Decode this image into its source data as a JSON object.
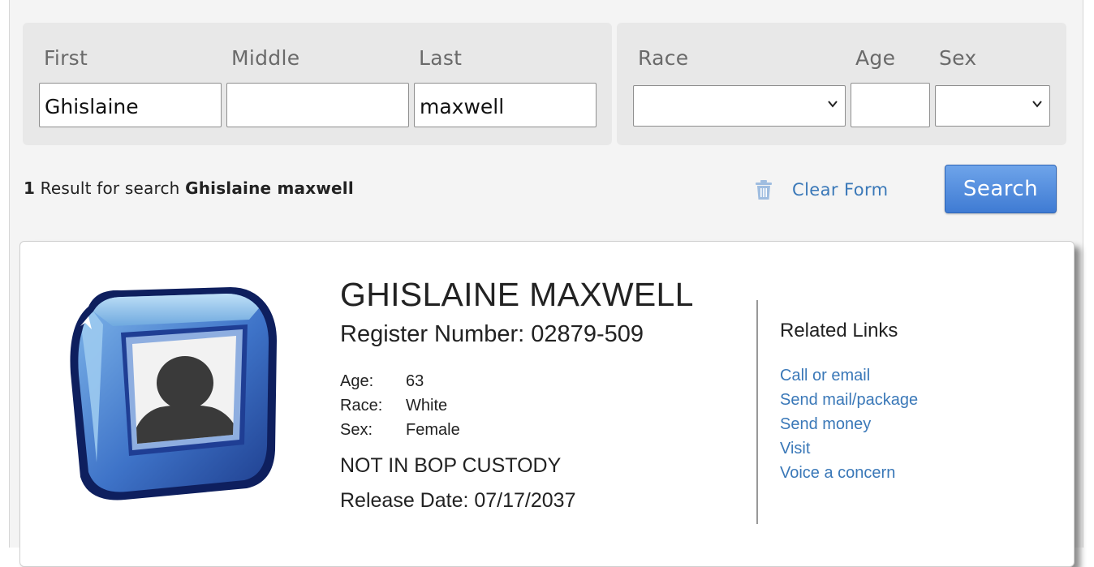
{
  "search_form": {
    "first_label": "First",
    "middle_label": "Middle",
    "last_label": "Last",
    "first_value": "Ghislaine",
    "middle_value": "",
    "last_value": "maxwell",
    "race_label": "Race",
    "age_label": "Age",
    "sex_label": "Sex",
    "race_selected": "",
    "age_value": "",
    "sex_selected": ""
  },
  "results": {
    "count": "1",
    "text": " Result for search ",
    "query": "Ghislaine maxwell"
  },
  "actions": {
    "clear_form_label": "Clear Form",
    "clear_icon": "trash-icon",
    "search_label": "Search"
  },
  "inmate": {
    "name": "GHISLAINE MAXWELL",
    "register_number": "Register Number: 02879-509",
    "age_label": "Age:",
    "age": "63",
    "race_label": "Race:",
    "race": "White",
    "sex_label": "Sex:",
    "sex": "Female",
    "custody_status": "NOT IN BOP CUSTODY",
    "release_date": "Release Date: 07/17/2037",
    "photo_icon": "person-placeholder-icon"
  },
  "related": {
    "title": "Related Links",
    "links": [
      {
        "label": "Call or email"
      },
      {
        "label": "Send mail/package"
      },
      {
        "label": "Send money"
      },
      {
        "label": "Visit"
      },
      {
        "label": "Voice a concern"
      }
    ]
  },
  "colors": {
    "link": "#3a78b8",
    "search_button": "#4a86da",
    "panel": "#e8e8e8"
  }
}
